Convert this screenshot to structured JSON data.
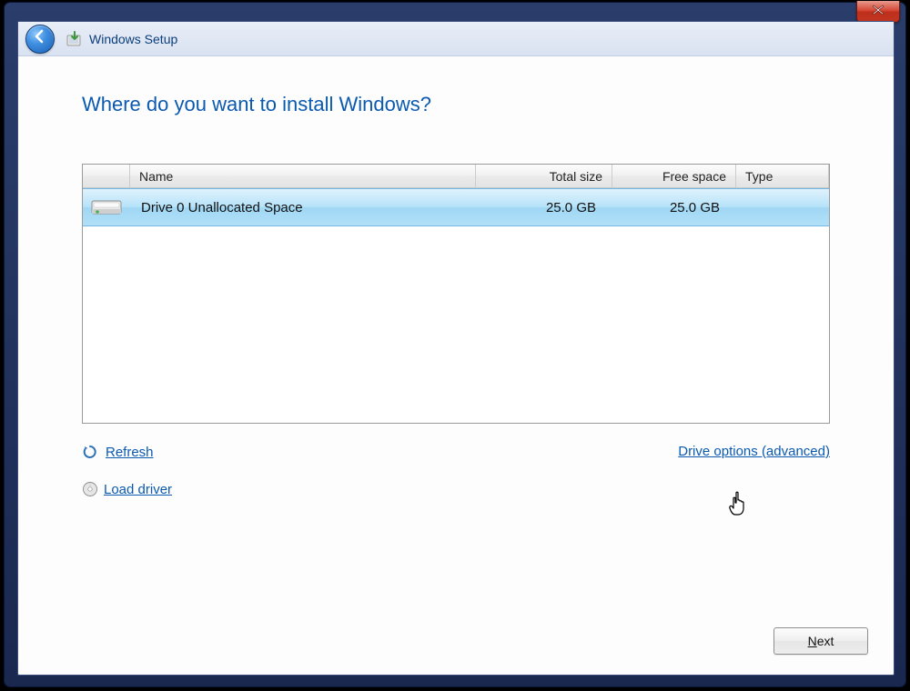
{
  "titlebar": {
    "title": "Windows Setup"
  },
  "heading": "Where do you want to install Windows?",
  "columns": {
    "name": "Name",
    "total": "Total size",
    "free": "Free space",
    "type": "Type"
  },
  "rows": [
    {
      "name": "Drive 0 Unallocated Space",
      "total": "25.0 GB",
      "free": "25.0 GB",
      "type": ""
    }
  ],
  "actions": {
    "refresh": "Refresh",
    "load_driver": "Load driver",
    "drive_options": "Drive options (advanced)"
  },
  "footer": {
    "next": "Next"
  }
}
